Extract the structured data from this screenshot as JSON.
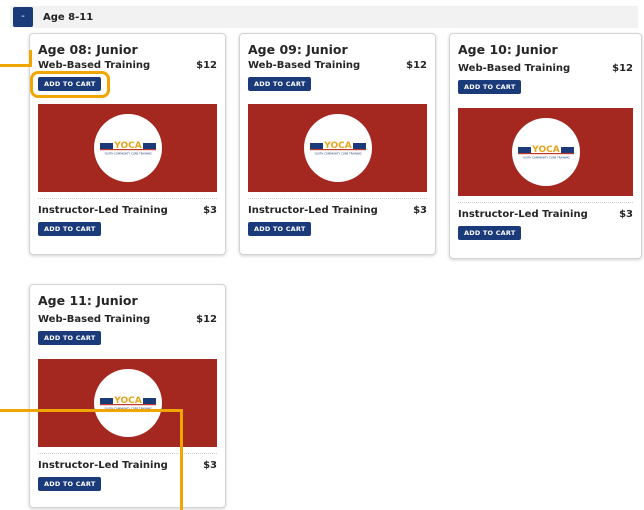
{
  "group": {
    "toggle_symbol": "-",
    "title": "Age 8-11"
  },
  "cards": [
    {
      "title": "Age 08: Junior",
      "web_label": "Web-Based Training",
      "web_price": "$12",
      "web_button": "ADD TO CART",
      "instructor_label": "Instructor-Led Training",
      "instructor_price": "$3",
      "instructor_button": "ADD TO CART"
    },
    {
      "title": "Age 09: Junior",
      "web_label": "Web-Based Training",
      "web_price": "$12",
      "web_button": "ADD TO CART",
      "instructor_label": "Instructor-Led Training",
      "instructor_price": "$3",
      "instructor_button": "ADD TO CART"
    },
    {
      "title": "Age 10: Junior",
      "web_label": "Web-Based Training",
      "web_price": "$12",
      "web_button": "ADD TO CART",
      "instructor_label": "Instructor-Led Training",
      "instructor_price": "$3",
      "instructor_button": "ADD TO CART"
    },
    {
      "title": "Age 11: Junior",
      "web_label": "Web-Based Training",
      "web_price": "$12",
      "web_button": "ADD TO CART",
      "instructor_label": "Instructor-Led Training",
      "instructor_price": "$3",
      "instructor_button": "ADD TO CART"
    }
  ],
  "logo": {
    "text": "YOCA",
    "subtext": "YOUTH COMMUNITY CORE TRAINING"
  },
  "colors": {
    "accent": "#1a3a7a",
    "banner": "#a4281f",
    "highlight": "#f0a500"
  }
}
